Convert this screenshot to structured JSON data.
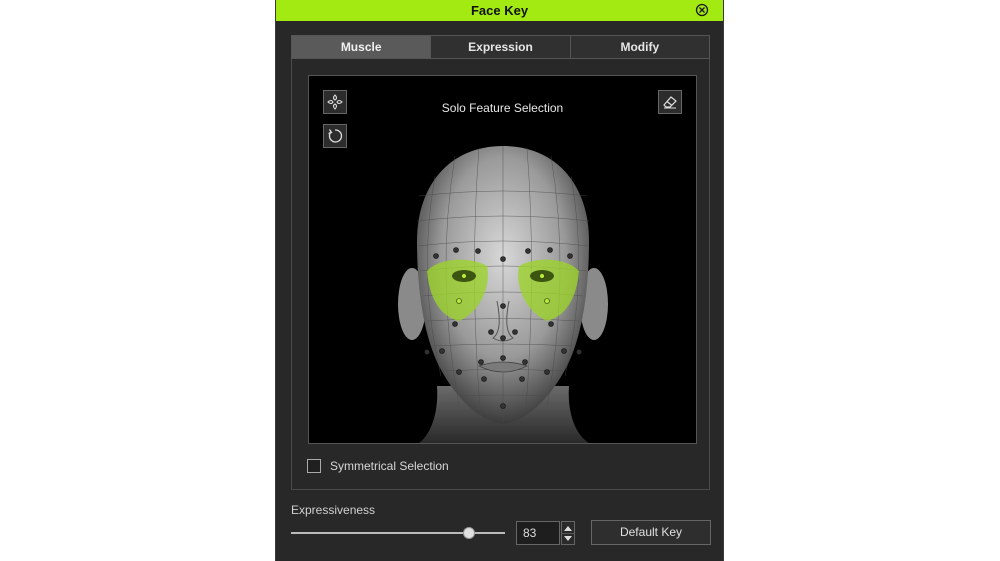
{
  "window": {
    "title": "Face Key"
  },
  "tabs": [
    {
      "label": "Muscle",
      "active": true
    },
    {
      "label": "Expression",
      "active": false
    },
    {
      "label": "Modify",
      "active": false
    }
  ],
  "viewport": {
    "title": "Solo Feature Selection",
    "highlight_color": "#9bd42a",
    "icons": [
      "move-icon",
      "reset-rotation-icon",
      "eraser-icon"
    ]
  },
  "symmetrical": {
    "label": "Symmetrical Selection",
    "checked": false
  },
  "expressiveness": {
    "label": "Expressiveness",
    "value": "83",
    "slider_fraction": 0.83
  },
  "default_key": {
    "label": "Default Key"
  },
  "colors": {
    "accent": "#a3ea12",
    "panel_bg": "#282828"
  }
}
